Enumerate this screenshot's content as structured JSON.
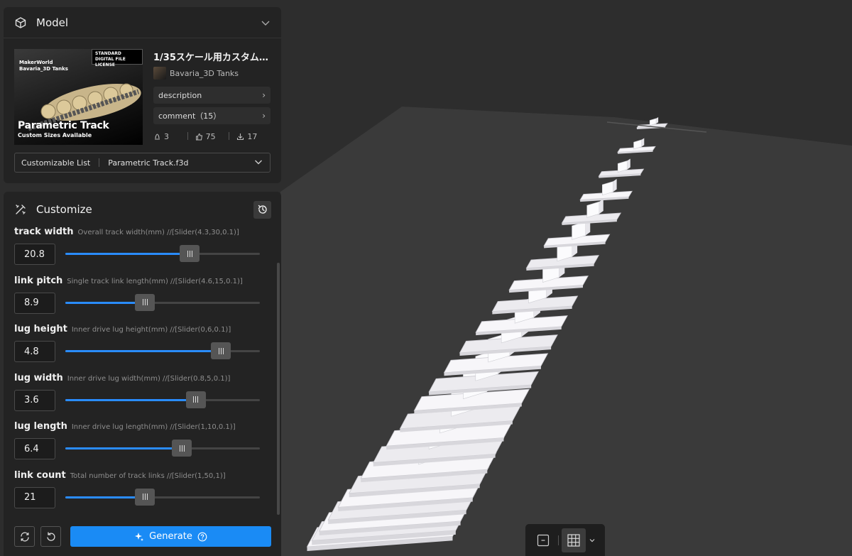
{
  "model": {
    "title": "Model",
    "thumbnail": {
      "license": "STANDARD DIGITAL FILE LICENSE",
      "brand": "MakerWorld Bavaria_3D Tanks",
      "headline": "Parametric Track",
      "subline": "Custom Sizes Available"
    },
    "name": "1/35スケール用カスタムパ…",
    "author": "Bavaria_3D Tanks",
    "description_label": "description",
    "comment_label": "comment（15）",
    "stats": {
      "boosts": "3",
      "likes": "75",
      "downloads": "17"
    },
    "list_label": "Customizable List",
    "list_value": "Parametric Track.f3d"
  },
  "customize": {
    "title": "Customize",
    "params": [
      {
        "name": "track width",
        "desc": "Overall track width(mm) //[Slider(4.3,30,0.1)]",
        "value": "20.8",
        "fraction": 0.64
      },
      {
        "name": "link pitch",
        "desc": "Single track link length(mm) //[Slider(4.6,15,0.1)]",
        "value": "8.9",
        "fraction": 0.41
      },
      {
        "name": "lug height",
        "desc": "Inner drive lug height(mm) //[Slider(0,6,0.1)]",
        "value": "4.8",
        "fraction": 0.8
      },
      {
        "name": "lug width",
        "desc": "Inner drive lug width(mm) //[Slider(0.8,5,0.1)]",
        "value": "3.6",
        "fraction": 0.67
      },
      {
        "name": "lug length",
        "desc": "Inner drive lug length(mm) //[Slider(1,10,0.1)]",
        "value": "6.4",
        "fraction": 0.6
      },
      {
        "name": "link count",
        "desc": "Total number of track links //[Slider(1,50,1)]",
        "value": "21",
        "fraction": 0.41
      }
    ],
    "generate_label": "Generate"
  },
  "colors": {
    "accent": "#1a8bf5",
    "panel": "#232323",
    "background": "#2d2d2d"
  },
  "icons": [
    "cube-icon",
    "chevron-down-icon",
    "customize-icon",
    "history-icon",
    "refresh-icon",
    "undo-icon",
    "sparkle-icon",
    "help-icon",
    "fit-view-icon",
    "grid-icon"
  ]
}
